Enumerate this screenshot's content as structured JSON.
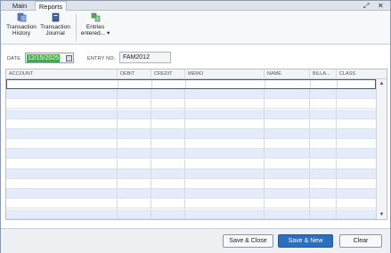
{
  "tabs": [
    {
      "label": "Main"
    },
    {
      "label": "Reports"
    }
  ],
  "window_controls": {
    "expand_icon": "expand-icon",
    "close_icon": "close-icon"
  },
  "ribbon": {
    "transaction_history": {
      "line1": "Transaction",
      "line2": "History",
      "icon": "transaction-history-icon"
    },
    "transaction_journal": {
      "line1": "Transaction",
      "line2": "Journal",
      "icon": "journal-icon"
    },
    "entries_entered": {
      "line1": "Entries",
      "line2": "entered...",
      "icon": "entries-icon"
    }
  },
  "form": {
    "date_label": "DATE",
    "date_value": "12/15/2025",
    "entry_no_label": "ENTRY NO.",
    "entry_no_value": "FAM2012"
  },
  "grid": {
    "columns": [
      "ACCOUNT",
      "DEBIT",
      "CREDIT",
      "MEMO",
      "NAME",
      "BILLA...",
      "CLASS"
    ]
  },
  "footer": {
    "save_close_label": "Save & Close",
    "save_new_label": "Save & New",
    "clear_label": "Clear"
  },
  "colors": {
    "accent": "#2b6fc0",
    "date_highlight": "#3fae3f",
    "row_alt": "#e3ecf8"
  }
}
